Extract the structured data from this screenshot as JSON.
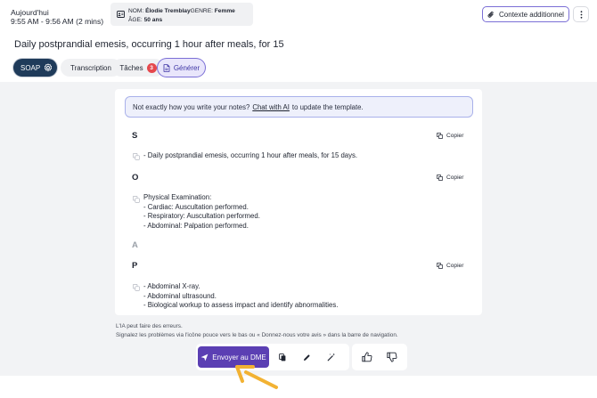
{
  "header": {
    "date_label": "Aujourd'hui",
    "time_range": "9:55 AM - 9:56 AM (2 mins)",
    "patient": {
      "name_label": "NOM:",
      "name_value": "Élodie Tremblay",
      "gender_label": "GENRE:",
      "gender_value": "Femme",
      "age_label": "ÂGE:",
      "age_value": "50 ans"
    },
    "context_button": "Contexte additionnel"
  },
  "note_title": "Daily postprandial emesis, occurring 1 hour after meals, for 15",
  "tabs": {
    "soap": "SOAP",
    "transcription": "Transcription",
    "tasks": "Tâches",
    "tasks_count": "3",
    "generate": "Générer"
  },
  "notice": {
    "before": "Not exactly how you write your notes?",
    "link": "Chat with AI",
    "after": "to update the template."
  },
  "copy_label": "Copier",
  "sections": {
    "s": {
      "letter": "S",
      "lines": [
        "- Daily postprandial emesis, occurring 1 hour after meals, for 15 days."
      ]
    },
    "o": {
      "letter": "O",
      "lines": [
        "Physical Examination:",
        "- Cardiac: Auscultation performed.",
        "- Respiratory: Auscultation performed.",
        "- Abdominal: Palpation performed."
      ]
    },
    "a": {
      "letter": "A"
    },
    "p": {
      "letter": "P",
      "lines": [
        "- Abdominal X-ray.",
        "- Abdominal ultrasound.",
        "- Biological workup to assess impact and identify abnormalities."
      ]
    }
  },
  "disclaimer": {
    "line1": "L'IA peut faire des erreurs.",
    "line2": "Signalez les problèmes via l'icône pouce vers le bas ou « Donnez-nous votre avis » dans la barre de navigation."
  },
  "actions": {
    "send_ehr": "Envoyer au DME"
  },
  "colors": {
    "accent": "#5b3fb3",
    "soap_tab": "#1f3b5a",
    "badge": "#e5484d",
    "cursor": "#f2b233"
  }
}
